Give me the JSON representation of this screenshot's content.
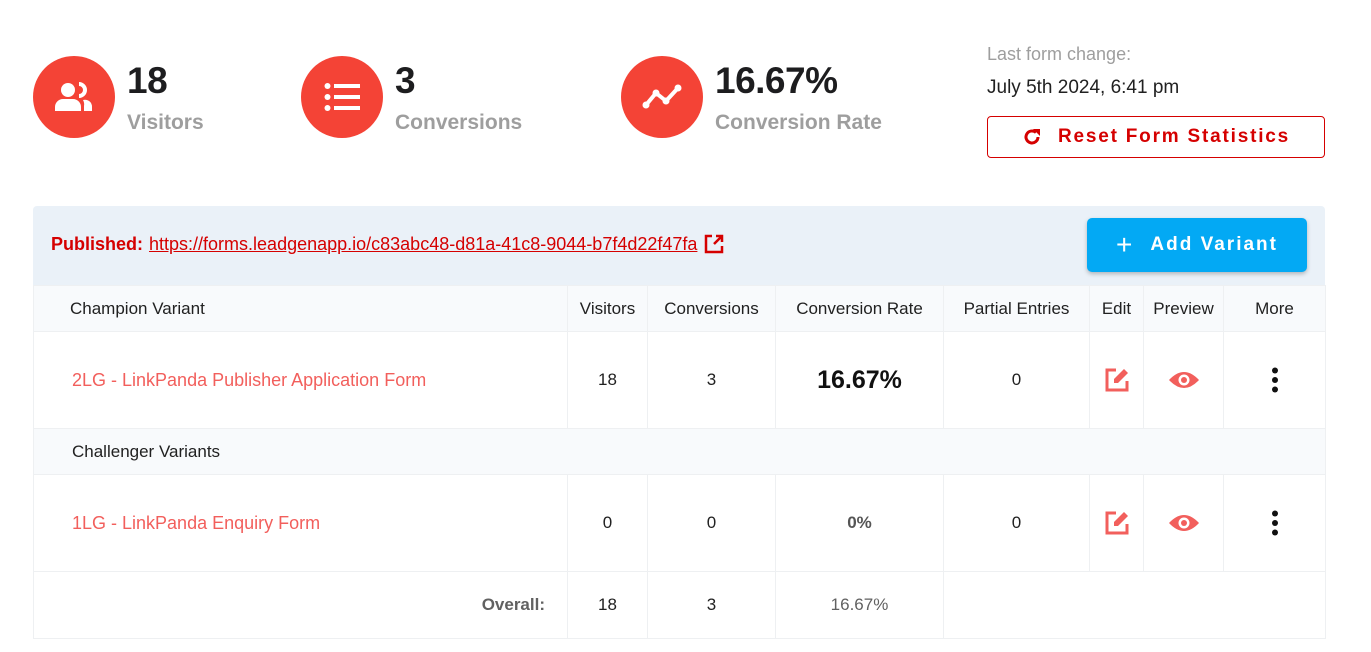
{
  "stats": {
    "visitors": {
      "value": "18",
      "label": "Visitors",
      "icon": "users-icon"
    },
    "conversions": {
      "value": "3",
      "label": "Conversions",
      "icon": "list-icon"
    },
    "rate": {
      "value": "16.67%",
      "label": "Conversion Rate",
      "icon": "trend-line-icon"
    }
  },
  "last_change": {
    "label": "Last form change:",
    "date": "July 5th 2024, 6:41 pm"
  },
  "reset_button": {
    "label": "Reset Form Statistics",
    "icon": "refresh-icon"
  },
  "published": {
    "label": "Published:",
    "url": "https://forms.leadgenapp.io/c83abc48-d81a-41c8-9044-b7f4d22f47fa",
    "icon": "external-link-icon"
  },
  "add_variant_button": {
    "label": "Add Variant",
    "icon": "plus-icon"
  },
  "table": {
    "columns": [
      "Champion Variant",
      "Visitors",
      "Conversions",
      "Conversion Rate",
      "Partial Entries",
      "Edit",
      "Preview",
      "More"
    ],
    "champion": {
      "name": "2LG - LinkPanda Publisher Application Form",
      "visitors": "18",
      "conversions": "3",
      "rate": "16.67%",
      "partial": "0"
    },
    "challenger_section_label": "Challenger Variants",
    "challengers": [
      {
        "name": "1LG - LinkPanda Enquiry Form",
        "visitors": "0",
        "conversions": "0",
        "rate": "0%",
        "partial": "0"
      }
    ],
    "overall": {
      "label": "Overall:",
      "visitors": "18",
      "conversions": "3",
      "rate": "16.67%"
    }
  },
  "colors": {
    "accent_red": "#f44336",
    "link_red": "#d50000",
    "variant_name": "#f25f5c",
    "add_button": "#03a9f4",
    "header_bg": "#eaf1f8"
  }
}
